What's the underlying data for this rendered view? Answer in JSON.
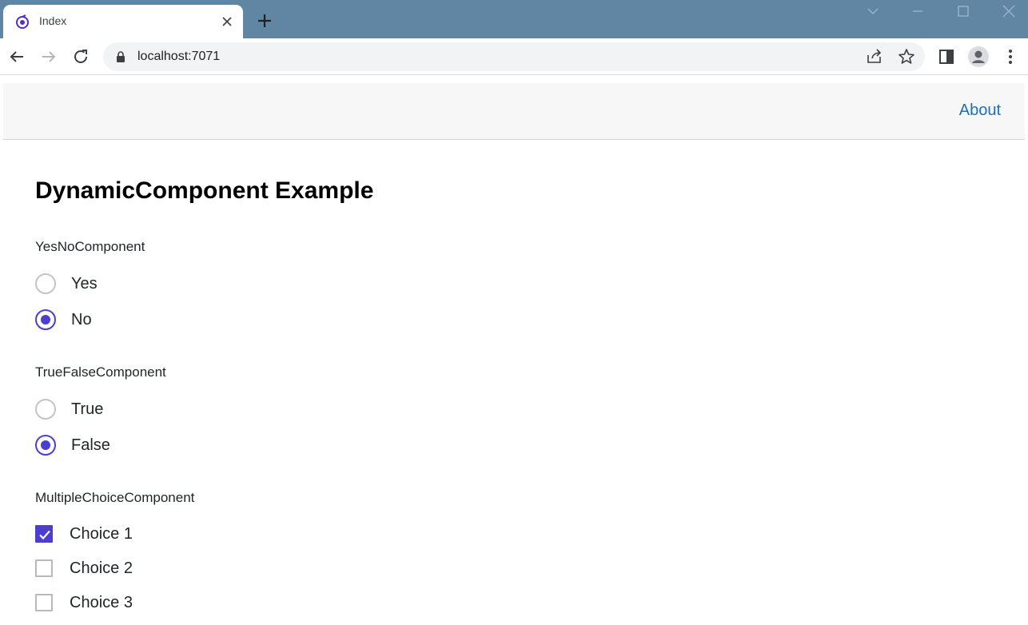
{
  "browser": {
    "tab_title": "Index",
    "url": "localhost:7071"
  },
  "navbar": {
    "about_label": "About",
    "link_color": "#1b6ec2"
  },
  "page": {
    "heading": "DynamicComponent Example",
    "accent_color": "#4b3fd0",
    "sections": [
      {
        "title": "YesNoComponent",
        "type": "radio",
        "options": [
          {
            "label": "Yes",
            "checked": false
          },
          {
            "label": "No",
            "checked": true
          }
        ]
      },
      {
        "title": "TrueFalseComponent",
        "type": "radio",
        "options": [
          {
            "label": "True",
            "checked": false
          },
          {
            "label": "False",
            "checked": true
          }
        ]
      },
      {
        "title": "MultipleChoiceComponent",
        "type": "checkbox",
        "options": [
          {
            "label": "Choice 1",
            "checked": true
          },
          {
            "label": "Choice 2",
            "checked": false
          },
          {
            "label": "Choice 3",
            "checked": false
          }
        ]
      }
    ]
  },
  "icons": {
    "favicon": "blazor-icon",
    "tab_close": "close-icon",
    "new_tab": "plus-icon",
    "back": "arrow-left-icon",
    "forward": "arrow-right-icon",
    "reload": "reload-icon",
    "lock": "lock-icon",
    "share": "share-icon",
    "bookmark": "star-icon",
    "side_panel": "side-panel-icon",
    "profile": "profile-icon",
    "menu": "kebab-menu-icon"
  }
}
